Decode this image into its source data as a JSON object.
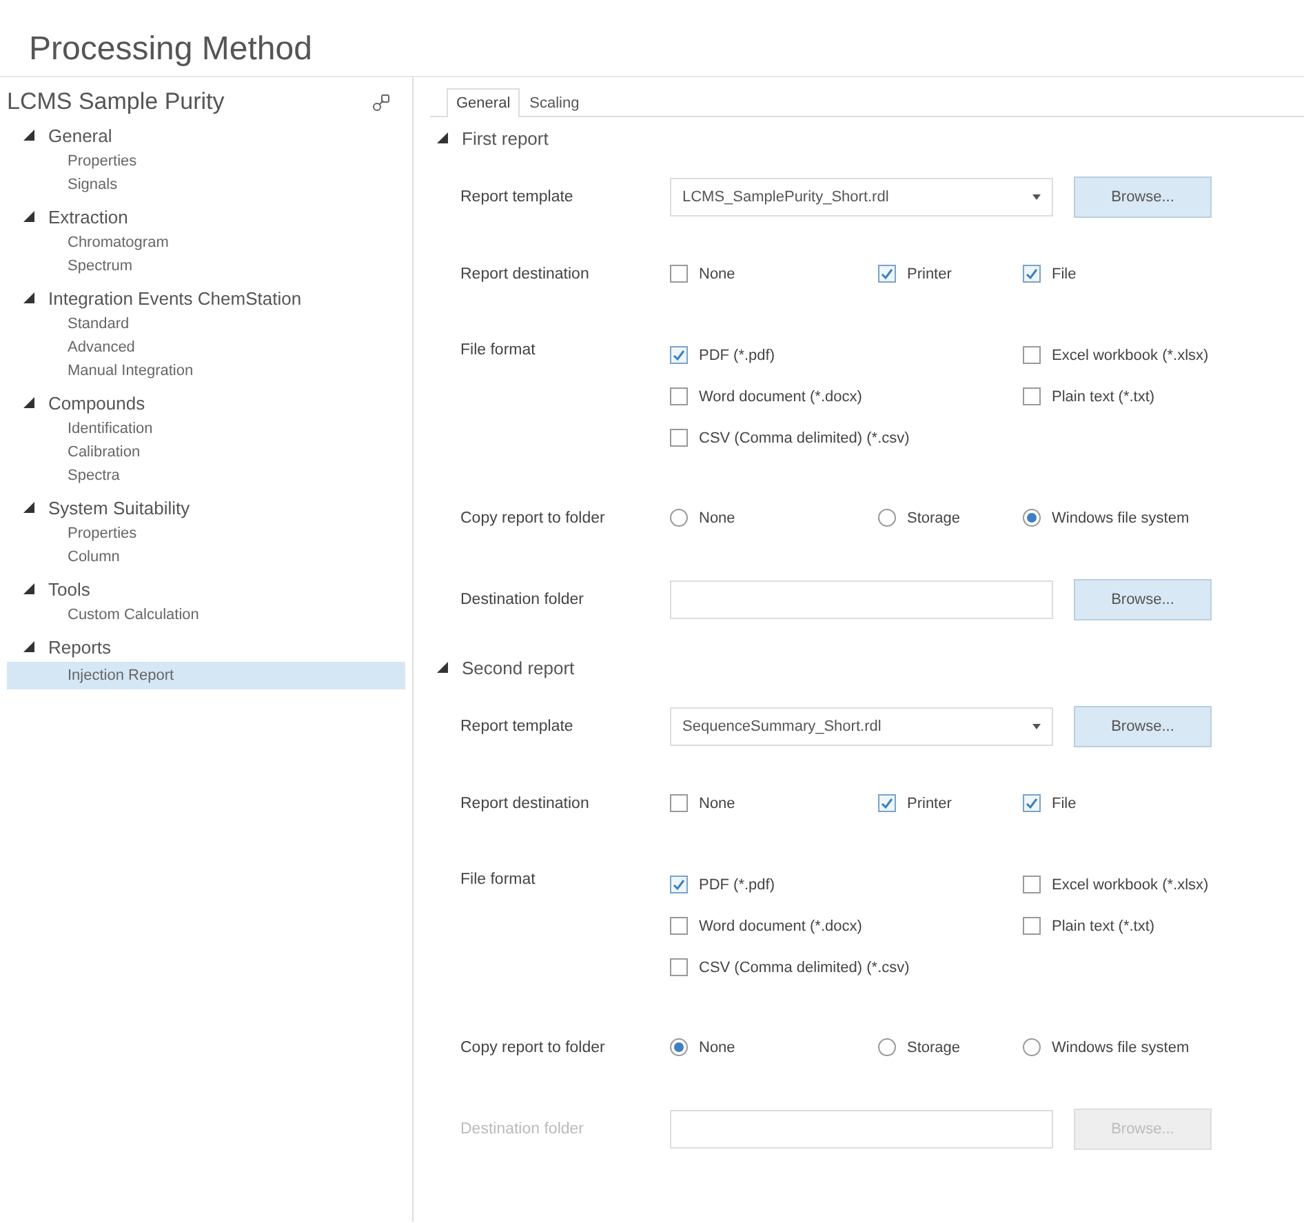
{
  "title": "Processing Method",
  "sidebar": {
    "title": "LCMS Sample Purity",
    "groups": [
      {
        "label": "General",
        "expanded": true,
        "children": [
          {
            "label": "Properties",
            "selected": false
          },
          {
            "label": "Signals",
            "selected": false
          }
        ]
      },
      {
        "label": "Extraction",
        "expanded": true,
        "children": [
          {
            "label": "Chromatogram",
            "selected": false
          },
          {
            "label": "Spectrum",
            "selected": false
          }
        ]
      },
      {
        "label": "Integration Events ChemStation",
        "expanded": true,
        "children": [
          {
            "label": "Standard",
            "selected": false
          },
          {
            "label": "Advanced",
            "selected": false
          },
          {
            "label": "Manual Integration",
            "selected": false
          }
        ]
      },
      {
        "label": "Compounds",
        "expanded": true,
        "children": [
          {
            "label": "Identification",
            "selected": false
          },
          {
            "label": "Calibration",
            "selected": false
          },
          {
            "label": "Spectra",
            "selected": false
          }
        ]
      },
      {
        "label": "System Suitability",
        "expanded": true,
        "children": [
          {
            "label": "Properties",
            "selected": false
          },
          {
            "label": "Column",
            "selected": false
          }
        ]
      },
      {
        "label": "Tools",
        "expanded": true,
        "children": [
          {
            "label": "Custom Calculation",
            "selected": false
          }
        ]
      },
      {
        "label": "Reports",
        "expanded": true,
        "children": [
          {
            "label": "Injection Report",
            "selected": true
          }
        ]
      }
    ]
  },
  "tabs": [
    {
      "label": "General",
      "selected": true
    },
    {
      "label": "Scaling",
      "selected": false
    }
  ],
  "sections": [
    {
      "title": "First report",
      "expanded": true,
      "template": {
        "label": "Report template",
        "value": "LCMS_SamplePurity_Short.rdl",
        "browse": "Browse..."
      },
      "destination": {
        "label": "Report destination",
        "options": [
          {
            "label": "None",
            "checked": false
          },
          {
            "label": "Printer",
            "checked": true
          },
          {
            "label": "File",
            "checked": true
          }
        ]
      },
      "format": {
        "label": "File format",
        "options": [
          {
            "label": "PDF (*.pdf)",
            "checked": true
          },
          {
            "label": "Excel workbook (*.xlsx)",
            "checked": false
          },
          {
            "label": "Word document (*.docx)",
            "checked": false
          },
          {
            "label": "Plain text (*.txt)",
            "checked": false
          },
          {
            "label": "CSV (Comma delimited) (*.csv)",
            "checked": false
          }
        ]
      },
      "copy": {
        "label": "Copy report to folder",
        "options": [
          {
            "label": "None",
            "selected": false
          },
          {
            "label": "Storage",
            "selected": false
          },
          {
            "label": "Windows file system",
            "selected": true
          }
        ]
      },
      "folder": {
        "label": "Destination folder",
        "browse": "Browse...",
        "disabled": false
      }
    },
    {
      "title": "Second report",
      "expanded": true,
      "template": {
        "label": "Report template",
        "value": "SequenceSummary_Short.rdl",
        "browse": "Browse..."
      },
      "destination": {
        "label": "Report destination",
        "options": [
          {
            "label": "None",
            "checked": false
          },
          {
            "label": "Printer",
            "checked": true
          },
          {
            "label": "File",
            "checked": true
          }
        ]
      },
      "format": {
        "label": "File format",
        "options": [
          {
            "label": "PDF (*.pdf)",
            "checked": true
          },
          {
            "label": "Excel workbook (*.xlsx)",
            "checked": false
          },
          {
            "label": "Word document (*.docx)",
            "checked": false
          },
          {
            "label": "Plain text (*.txt)",
            "checked": false
          },
          {
            "label": "CSV (Comma delimited) (*.csv)",
            "checked": false
          }
        ]
      },
      "copy": {
        "label": "Copy report to folder",
        "options": [
          {
            "label": "None",
            "selected": true
          },
          {
            "label": "Storage",
            "selected": false
          },
          {
            "label": "Windows file system",
            "selected": false
          }
        ]
      },
      "folder": {
        "label": "Destination folder",
        "browse": "Browse...",
        "disabled": true
      }
    }
  ]
}
